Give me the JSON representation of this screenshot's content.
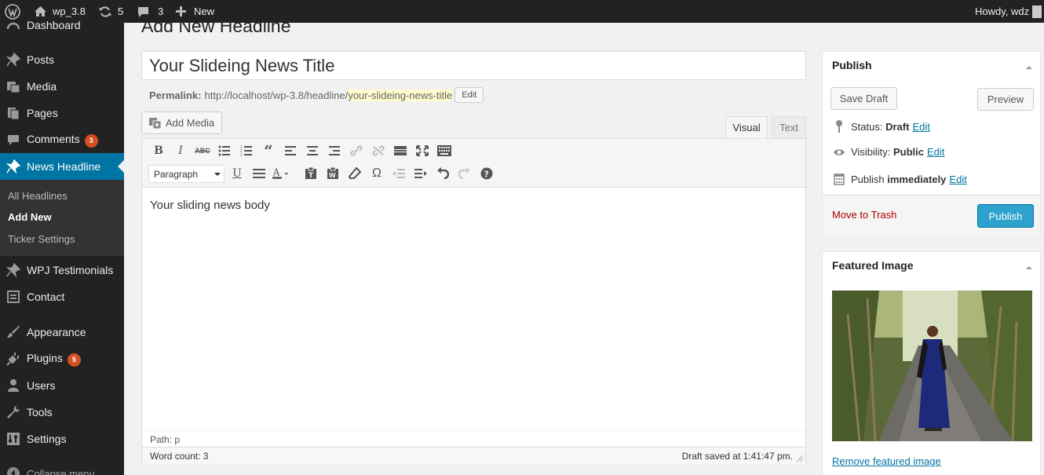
{
  "adminbar": {
    "site_name": "wp_3.8",
    "updates_count": "5",
    "comments_count": "3",
    "new_label": "New",
    "howdy": "Howdy, wdz"
  },
  "sidebar": {
    "dashboard": "Dashboard",
    "posts": "Posts",
    "media": "Media",
    "pages": "Pages",
    "comments": "Comments",
    "comments_badge": "3",
    "news_headline": "News Headline",
    "submenu": [
      "All Headlines",
      "Add New",
      "Ticker Settings"
    ],
    "testimonials": "WPJ Testimonials",
    "contact": "Contact",
    "appearance": "Appearance",
    "plugins": "Plugins",
    "plugins_badge": "5",
    "users": "Users",
    "tools": "Tools",
    "settings": "Settings",
    "collapse": "Collapse menu"
  },
  "main": {
    "page_title": "Add New Headline",
    "title_value": "Your Slideing News Title",
    "permalink_label": "Permalink:",
    "permalink_base": "http://localhost/wp-3.8/headline/",
    "permalink_slug": "your-slideing-news-title",
    "permalink_edit": "Edit",
    "add_media": "Add Media",
    "tab_visual": "Visual",
    "tab_text": "Text",
    "format_select": "Paragraph",
    "body_text": "Your sliding news body",
    "path": "Path: p",
    "word_count": "Word count: 3",
    "draft_saved": "Draft saved at 1:41:47 pm."
  },
  "publish": {
    "title": "Publish",
    "save_draft": "Save Draft",
    "preview": "Preview",
    "status_label": "Status:",
    "status_value": "Draft",
    "visibility_label": "Visibility:",
    "visibility_value": "Public",
    "publish_label": "Publish",
    "publish_value": "immediately",
    "edit": "Edit",
    "move_to_trash": "Move to Trash",
    "publish_button": "Publish"
  },
  "featured": {
    "title": "Featured Image",
    "remove": "Remove featured image"
  },
  "colors": {
    "admin_bar": "#222222",
    "active_menu": "#0074a2",
    "publish_button": "#2ea2cc",
    "badge": "#d54e21",
    "trash": "#aa0000"
  }
}
